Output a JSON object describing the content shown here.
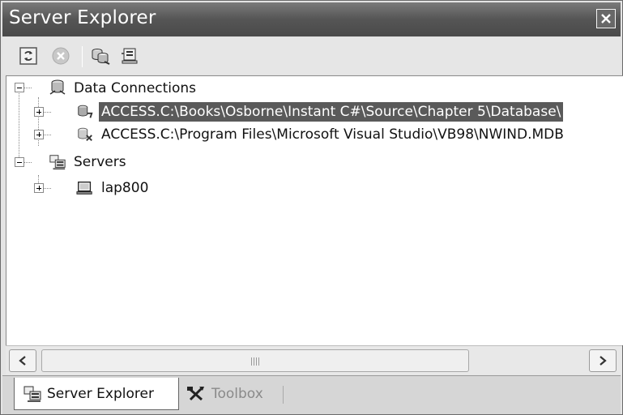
{
  "window": {
    "title": "Server Explorer"
  },
  "toolbar": {
    "buttons": [
      {
        "name": "refresh"
      },
      {
        "name": "stop"
      },
      {
        "name": "connect-to-database"
      },
      {
        "name": "connect-to-server"
      }
    ]
  },
  "tree": {
    "nodes": [
      {
        "label": "Data Connections",
        "expanded": true
      },
      {
        "label": "ACCESS.C:\\Books\\Osborne\\Instant C#\\Source\\Chapter 5\\Database\\",
        "selected": true
      },
      {
        "label": "ACCESS.C:\\Program Files\\Microsoft Visual Studio\\VB98\\NWIND.MDB"
      },
      {
        "label": "Servers",
        "expanded": true
      },
      {
        "label": "lap800"
      }
    ]
  },
  "tabs": [
    {
      "label": "Server Explorer",
      "active": true
    },
    {
      "label": "Toolbox",
      "active": false
    }
  ],
  "colors": {
    "titlebar": "#555555",
    "selection": "#5a5a5a"
  }
}
